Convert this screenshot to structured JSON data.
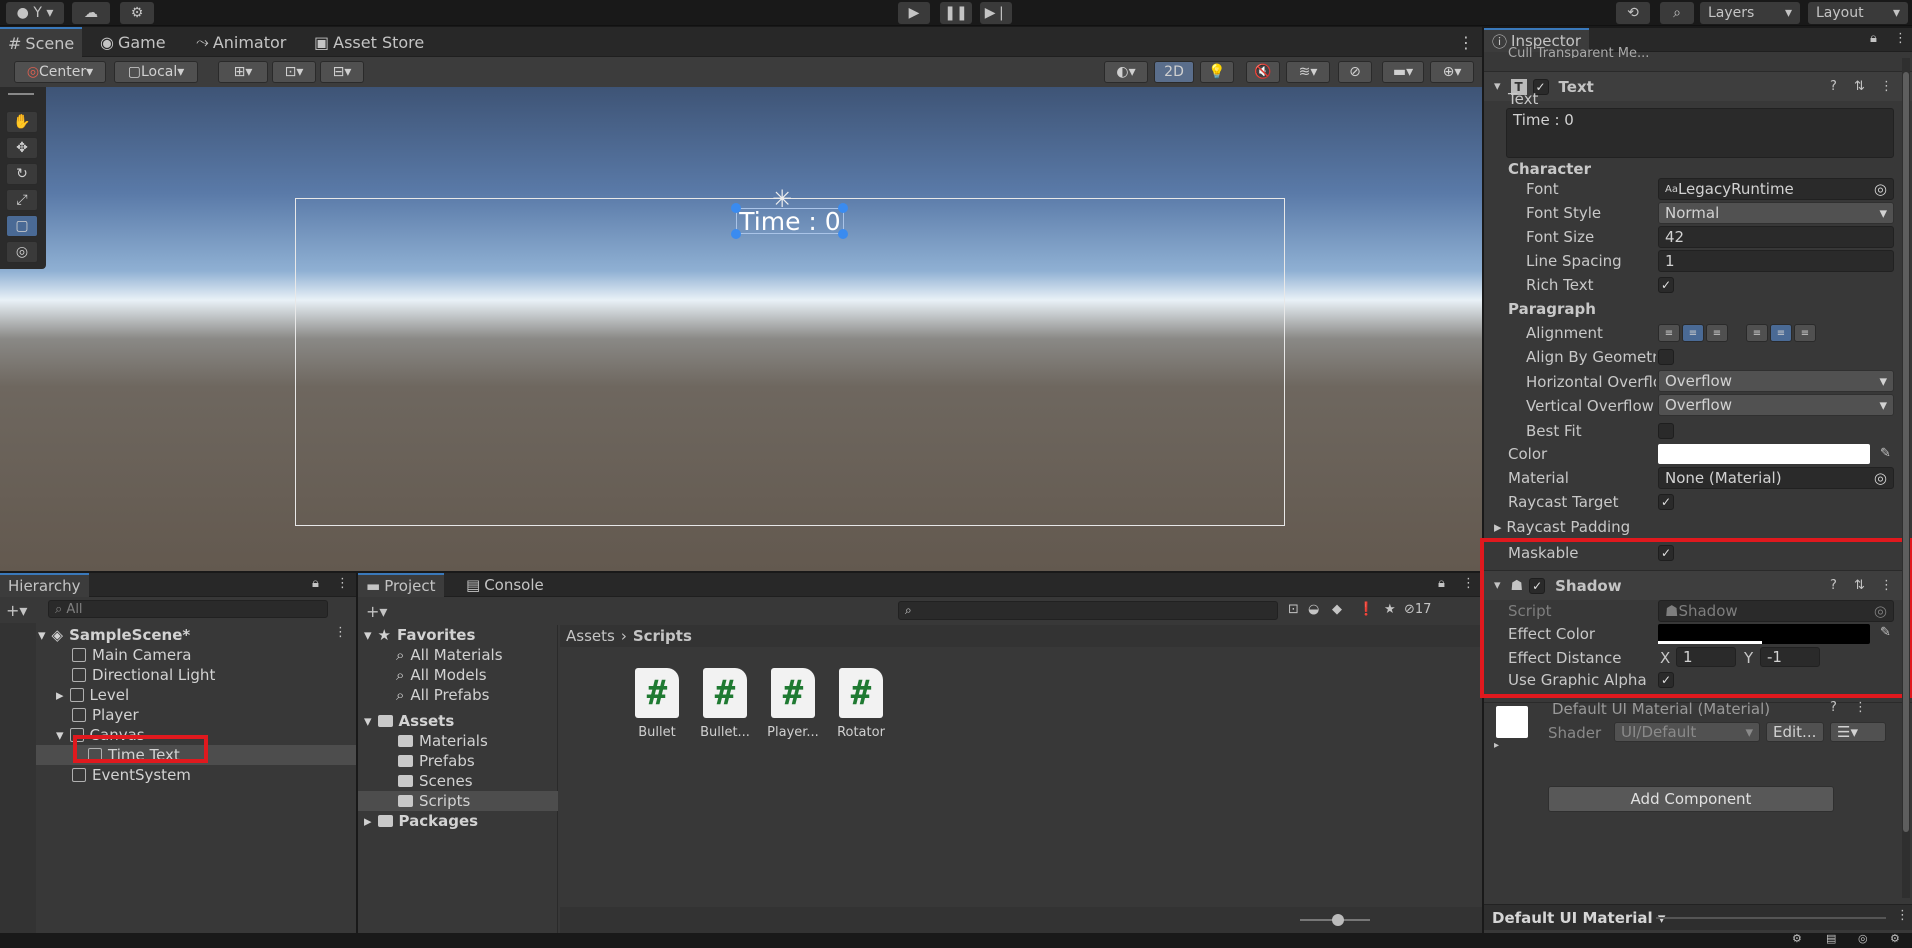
{
  "topbar": {
    "account": "Y",
    "layers": "Layers",
    "layout": "Layout"
  },
  "scene_tabs": [
    {
      "label": "Scene"
    },
    {
      "label": "Game"
    },
    {
      "label": "Animator"
    },
    {
      "label": "Asset Store"
    }
  ],
  "scene_toolbar": {
    "pivot": "Center",
    "space": "Local",
    "mode2d": "2D"
  },
  "scene": {
    "ui_text": "Time : 0"
  },
  "hierarchy": {
    "title": "Hierarchy",
    "search_placeholder": "All",
    "items": [
      "SampleScene*",
      "Main Camera",
      "Directional Light",
      "Level",
      "Player",
      "Canvas",
      "Time Text",
      "EventSystem"
    ]
  },
  "project": {
    "tabs": [
      {
        "label": "Project"
      },
      {
        "label": "Console"
      }
    ],
    "hidden_count": "17",
    "favorites": {
      "label": "Favorites",
      "items": [
        "All Materials",
        "All Models",
        "All Prefabs"
      ]
    },
    "assets": {
      "label": "Assets",
      "items": [
        "Materials",
        "Prefabs",
        "Scenes",
        "Scripts"
      ]
    },
    "packages": "Packages",
    "breadcrumb": [
      "Assets",
      "Scripts"
    ],
    "files": [
      "Bullet",
      "Bullet...",
      "Player...",
      "Rotator"
    ]
  },
  "inspector": {
    "title": "Inspector",
    "cut_text": "Cull Transparent Me...",
    "text_component": {
      "header": "Text",
      "text_label": "Text",
      "text_value": "Time : 0",
      "character": "Character",
      "font_label": "Font",
      "font_value": "LegacyRuntime",
      "font_style_label": "Font Style",
      "font_style_value": "Normal",
      "font_size_label": "Font Size",
      "font_size_value": "42",
      "line_spacing_label": "Line Spacing",
      "line_spacing_value": "1",
      "rich_text_label": "Rich Text",
      "paragraph": "Paragraph",
      "alignment_label": "Alignment",
      "align_geom_label": "Align By Geometry",
      "h_overflow_label": "Horizontal Overflow",
      "h_overflow_value": "Overflow",
      "v_overflow_label": "Vertical Overflow",
      "v_overflow_value": "Overflow",
      "best_fit_label": "Best Fit",
      "color_label": "Color",
      "material_label": "Material",
      "material_value": "None (Material)",
      "raycast_target_label": "Raycast Target",
      "raycast_padding_label": "Raycast Padding",
      "maskable_label": "Maskable"
    },
    "shadow_component": {
      "header": "Shadow",
      "script_label": "Script",
      "script_value": "Shadow",
      "effect_color_label": "Effect Color",
      "effect_distance_label": "Effect Distance",
      "x_label": "X",
      "x_value": "1",
      "y_label": "Y",
      "y_value": "-1",
      "use_alpha_label": "Use Graphic Alpha"
    },
    "material_block": {
      "name": "Default UI Material (Material)",
      "shader_label": "Shader",
      "shader_value": "UI/Default",
      "edit": "Edit..."
    },
    "add_component": "Add Component",
    "footer": "Default UI Material"
  },
  "colors": {
    "accent": "#3a79bb",
    "highlight": "#e0191e",
    "script_green": "#1f7a32"
  }
}
